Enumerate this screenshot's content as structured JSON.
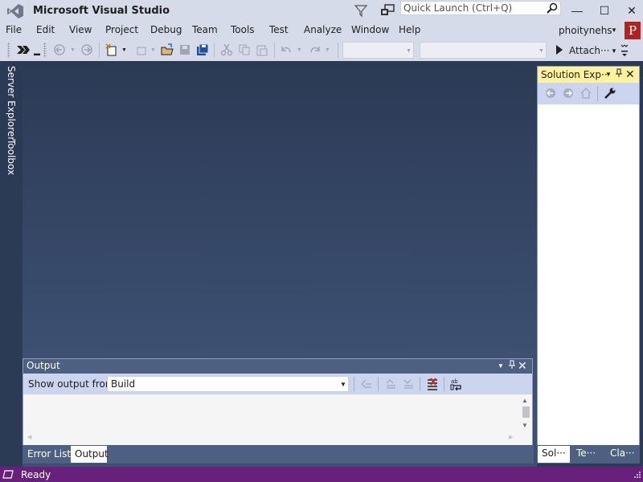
{
  "window": {
    "title": "Microsoft Visual Studio",
    "quick_launch_placeholder": "Quick Launch (Ctrl+Q)",
    "min_glyph": "—",
    "max_glyph": "☐",
    "close_glyph": "✕"
  },
  "menu": {
    "items": [
      "File",
      "Edit",
      "View",
      "Project",
      "Debug",
      "Team",
      "Tools",
      "Test",
      "Analyze",
      "Window",
      "Help"
    ],
    "user_name": "phoitynehs",
    "avatar_letter": "P"
  },
  "toolbar": {
    "attach_label": "Attach···",
    "icons": [
      "solution-config-icon",
      "back-icon",
      "forward-icon",
      "new-project-icon",
      "add-item-icon",
      "open-file-icon",
      "save-icon",
      "save-all-icon",
      "cut-icon",
      "copy-icon",
      "paste-icon",
      "undo-icon",
      "redo-icon"
    ]
  },
  "side_tabs": {
    "server_explorer": "Server Explorer",
    "toolbox": "Toolbox"
  },
  "solution_explorer": {
    "title": "Solution Exp···",
    "tabs": [
      "Sol···",
      "Te···",
      "Cla···"
    ]
  },
  "output": {
    "title": "Output",
    "show_from_label": "Show output from:",
    "source_value": "Build",
    "tabs": [
      "Error List",
      "Output"
    ]
  },
  "status": {
    "text": "Ready"
  },
  "colors": {
    "chrome": "#d6dbe9",
    "editor_bg": "#2b3a55",
    "status_bar": "#68217a",
    "active_tool_window": "#fff29d",
    "avatar": "#b32121"
  }
}
